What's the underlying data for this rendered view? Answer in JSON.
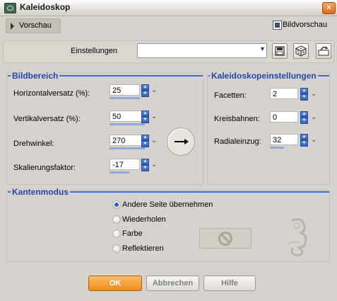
{
  "window": {
    "title": "Kaleidoskop",
    "close_label": "×"
  },
  "preview": {
    "toggle_label": "Vorschau",
    "image_preview_label": "Bildvorschau",
    "image_preview_checked": true
  },
  "presets": {
    "label": "Einstellungen",
    "selected": ""
  },
  "bildbereich": {
    "title": "Bildbereich",
    "fields": [
      {
        "label": "Horizontalversatz (%):",
        "value": "25"
      },
      {
        "label": "Vertikalversatz (%):",
        "value": "50"
      },
      {
        "label": "Drehwinkel:",
        "value": "270"
      },
      {
        "label": "Skalierungsfaktor:",
        "value": "-17"
      }
    ]
  },
  "kaleido": {
    "title": "Kaleidoskopeinstellungen",
    "fields": [
      {
        "label": "Facetten:",
        "value": "2"
      },
      {
        "label": "Kreisbahnen:",
        "value": "0"
      },
      {
        "label": "Radialeinzug:",
        "value": "32"
      }
    ]
  },
  "kantenmodus": {
    "title": "Kantenmodus",
    "options": [
      {
        "label": "Andere Seite übernehmen",
        "checked": true
      },
      {
        "label": "Wiederholen",
        "checked": false
      },
      {
        "label": "Farbe",
        "checked": false
      },
      {
        "label": "Reflektieren",
        "checked": false
      }
    ]
  },
  "buttons": {
    "ok": "OK",
    "cancel": "Abbrechen",
    "help": "Hilfe"
  },
  "colors": {
    "accent": "#3c6cd9",
    "group_title": "#2446a8",
    "ok": "#ee8a16"
  }
}
